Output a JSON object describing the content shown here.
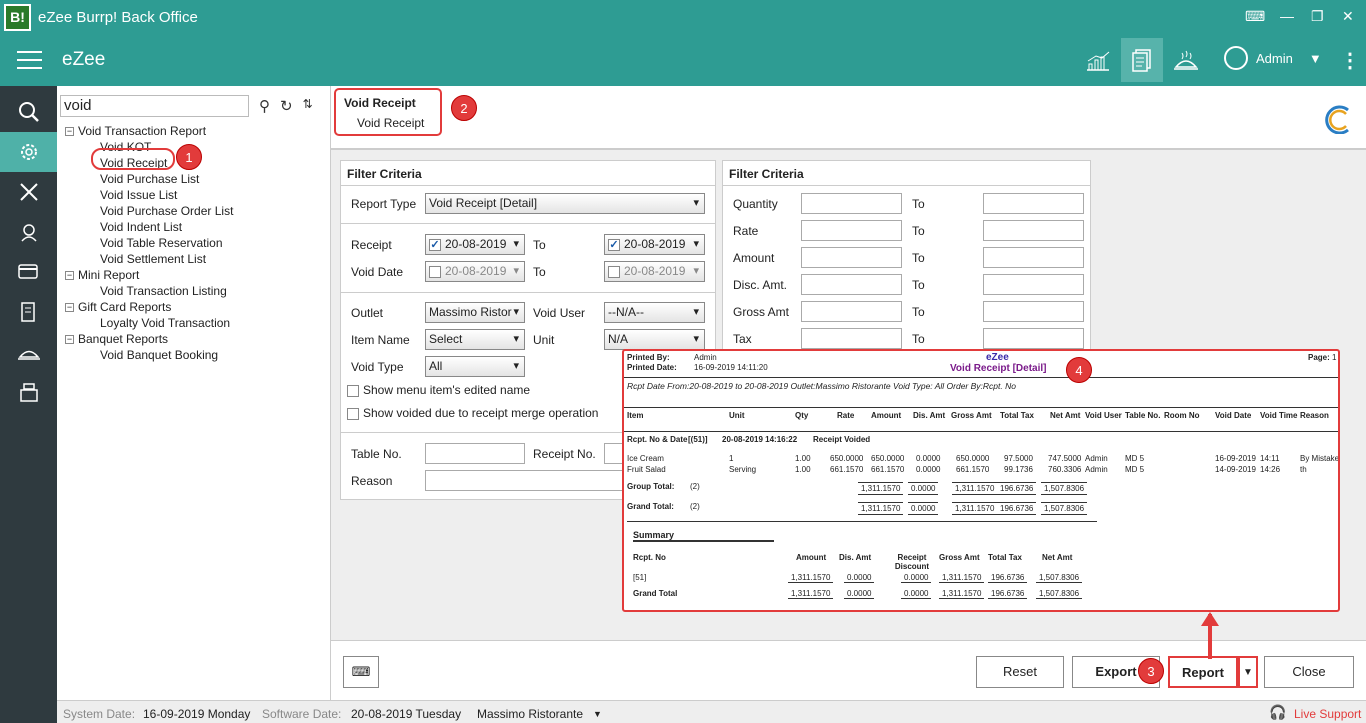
{
  "app": {
    "logo": "B!",
    "title": "eZee Burrp! Back Office",
    "brand": "eZee",
    "user": "Admin"
  },
  "search": {
    "value": "void"
  },
  "tree": [
    {
      "label": "Void Transaction Report",
      "level": 0,
      "expanded": true
    },
    {
      "label": "Void KOT",
      "level": 1
    },
    {
      "label": "Void Receipt",
      "level": 1,
      "selected": true
    },
    {
      "label": "Void Purchase List",
      "level": 1
    },
    {
      "label": "Void Issue List",
      "level": 1
    },
    {
      "label": "Void Purchase Order List",
      "level": 1
    },
    {
      "label": "Void Indent List",
      "level": 1
    },
    {
      "label": "Void Table Reservation",
      "level": 1
    },
    {
      "label": "Void Settlement List",
      "level": 1
    },
    {
      "label": "Mini Report",
      "level": 0,
      "expanded": true
    },
    {
      "label": "Void Transaction Listing",
      "level": 1
    },
    {
      "label": "Gift Card Reports",
      "level": 0,
      "expanded": true
    },
    {
      "label": "Loyalty Void Transaction",
      "level": 1
    },
    {
      "label": "Banquet Reports",
      "level": 0,
      "expanded": true
    },
    {
      "label": "Void Banquet Booking",
      "level": 1
    }
  ],
  "breadcrumb": {
    "title": "Void Receipt",
    "sub": "Void Receipt"
  },
  "callouts": [
    "1",
    "2",
    "3",
    "4"
  ],
  "filter1": {
    "title": "Filter Criteria",
    "report_type_label": "Report Type",
    "report_type": "Void Receipt [Detail]",
    "receipt_label": "Receipt",
    "receipt_from": "20-08-2019",
    "to_label": "To",
    "receipt_to": "20-08-2019",
    "void_date_label": "Void Date",
    "void_from": "20-08-2019",
    "void_to": "20-08-2019",
    "outlet_label": "Outlet",
    "outlet": "Massimo Ristor",
    "void_user_label": "Void User",
    "void_user": "--N/A--",
    "item_name_label": "Item Name",
    "item_name": "Select",
    "unit_label": "Unit",
    "unit": "N/A",
    "void_type_label": "Void Type",
    "void_type": "All",
    "show_edited": "Show menu item's edited name",
    "show_merged": "Show voided due to receipt merge operation",
    "table_no_label": "Table No.",
    "receipt_no_label": "Receipt No.",
    "reason_label": "Reason"
  },
  "filter2": {
    "title": "Filter Criteria",
    "rows": [
      "Quantity",
      "Rate",
      "Amount",
      "Disc. Amt.",
      "Gross Amt",
      "Tax"
    ],
    "to_label": "To"
  },
  "report": {
    "printed_by_label": "Printed By:",
    "printed_by": "Admin",
    "printed_date_label": "Printed Date:",
    "printed_date": "16-09-2019 14:11:20",
    "company": "eZee",
    "title": "Void Receipt [Detail]",
    "page_label": "Page:",
    "page": "1",
    "criteria": "Rcpt Date From:20-08-2019 to 20-08-2019  Outlet:Massimo Ristorante  Void Type: All Order By:Rcpt. No",
    "columns": [
      "Item",
      "Unit",
      "Qty",
      "Rate",
      "Amount",
      "Dis. Amt",
      "Gross Amt",
      "Total Tax",
      "Net Amt",
      "Void User",
      "Table No.",
      "Room No",
      "Void Date",
      "Void Time",
      "Reason"
    ],
    "group_label": "Rcpt. No & Date",
    "group_no": "[(51)]",
    "group_date": "20-08-2019 14:16:22",
    "group_status": "Receipt Voided",
    "rows": [
      {
        "item": "Ice Cream",
        "unit": "1",
        "qty": "1.00",
        "rate": "650.0000",
        "amount": "650.0000",
        "dis": "0.0000",
        "gross": "650.0000",
        "tax": "97.5000",
        "net": "747.5000",
        "user": "Admin",
        "table": "MD 5",
        "vdate": "16-09-2019",
        "vtime": "14:11",
        "reason": "By Mistake"
      },
      {
        "item": "Fruit Salad",
        "unit": "Serving",
        "qty": "1.00",
        "rate": "661.1570",
        "amount": "661.1570",
        "dis": "0.0000",
        "gross": "661.1570",
        "tax": "99.1736",
        "net": "760.3306",
        "user": "Admin",
        "table": "MD 5",
        "vdate": "14-09-2019",
        "vtime": "14:26",
        "reason": "th"
      }
    ],
    "group_total_label": "Group Total:",
    "grand_total_label": "Grand Total:",
    "count": "(2)",
    "totals": {
      "amount": "1,311.1570",
      "dis": "0.0000",
      "gross": "1,311.1570",
      "tax": "196.6736",
      "net": "1,507.8306"
    },
    "summary_title": "Summary",
    "summary_cols": [
      "Rcpt. No",
      "Amount",
      "Dis. Amt",
      "Receipt Discount",
      "Gross Amt",
      "Total Tax",
      "Net Amt"
    ],
    "summary_row": {
      "no": "[51]",
      "amount": "1,311.1570",
      "dis": "0.0000",
      "rdis": "0.0000",
      "gross": "1,311.1570",
      "tax": "196.6736",
      "net": "1,507.8306"
    },
    "summary_total_label": "Grand Total"
  },
  "buttons": {
    "reset": "Reset",
    "export": "Export",
    "report": "Report",
    "close": "Close"
  },
  "status": {
    "system_date_label": "System Date:",
    "system_date": "16-09-2019 Monday",
    "software_date_label": "Software Date:",
    "software_date": "20-08-2019 Tuesday",
    "outlet": "Massimo Ristorante",
    "live_support": "Live Support"
  }
}
